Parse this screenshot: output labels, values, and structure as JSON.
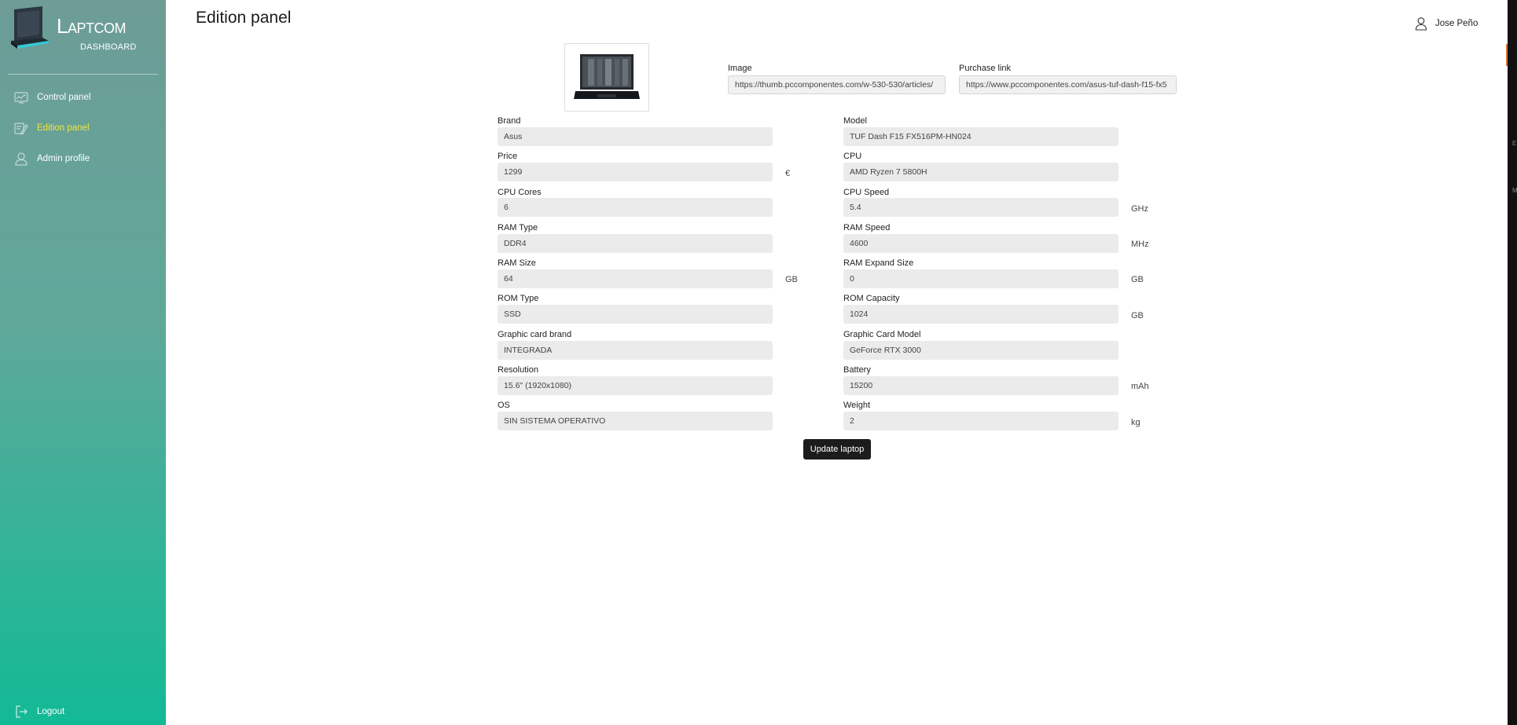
{
  "app": {
    "brand_name": "Laptcom",
    "brand_sub": "DASHBOARD"
  },
  "sidebar": {
    "items": [
      {
        "label": "Control panel",
        "icon": "dashboard-icon"
      },
      {
        "label": "Edition panel",
        "icon": "edit-icon",
        "active": true
      },
      {
        "label": "Admin profile",
        "icon": "user-icon"
      }
    ],
    "logout_label": "Logout"
  },
  "header": {
    "title": "Edition panel",
    "user_name": "Jose Peño"
  },
  "form": {
    "image": {
      "label": "Image",
      "value": "https://thumb.pccomponentes.com/w-530-530/articles/"
    },
    "purchase_link": {
      "label": "Purchase link",
      "value": "https://www.pccomponentes.com/asus-tuf-dash-f15-fx5"
    },
    "brand": {
      "label": "Brand",
      "value": "Asus"
    },
    "model": {
      "label": "Model",
      "value": "TUF Dash F15 FX516PM-HN024"
    },
    "price": {
      "label": "Price",
      "value": "1299",
      "unit": "€"
    },
    "cpu": {
      "label": "CPU",
      "value": "AMD Ryzen 7 5800H"
    },
    "cpu_cores": {
      "label": "CPU Cores",
      "value": "6"
    },
    "cpu_speed": {
      "label": "CPU Speed",
      "value": "5.4",
      "unit": "GHz"
    },
    "ram_type": {
      "label": "RAM Type",
      "value": "DDR4"
    },
    "ram_speed": {
      "label": "RAM Speed",
      "value": "4600",
      "unit": "MHz"
    },
    "ram_size": {
      "label": "RAM Size",
      "value": "64",
      "unit": "GB"
    },
    "ram_expand_size": {
      "label": "RAM Expand Size",
      "value": "0",
      "unit": "GB"
    },
    "rom_type": {
      "label": "ROM Type",
      "value": "SSD"
    },
    "rom_capacity": {
      "label": "ROM Capacity",
      "value": "1024",
      "unit": "GB"
    },
    "gpu_brand": {
      "label": "Graphic card brand",
      "value": "INTEGRADA"
    },
    "gpu_model": {
      "label": "Graphic Card Model",
      "value": "GeForce RTX 3000"
    },
    "resolution": {
      "label": "Resolution",
      "value": "15.6\" (1920x1080)"
    },
    "battery": {
      "label": "Battery",
      "value": "15200",
      "unit": "mAh"
    },
    "os": {
      "label": "OS",
      "value": "SIN SISTEMA OPERATIVO"
    },
    "weight": {
      "label": "Weight",
      "value": "2",
      "unit": "kg"
    },
    "submit_label": "Update laptop"
  },
  "colors": {
    "accent_active": "#f3e43b",
    "sidebar_top": "#6e9c97",
    "sidebar_bottom": "#13b996",
    "button_bg": "#1c1c1c"
  }
}
